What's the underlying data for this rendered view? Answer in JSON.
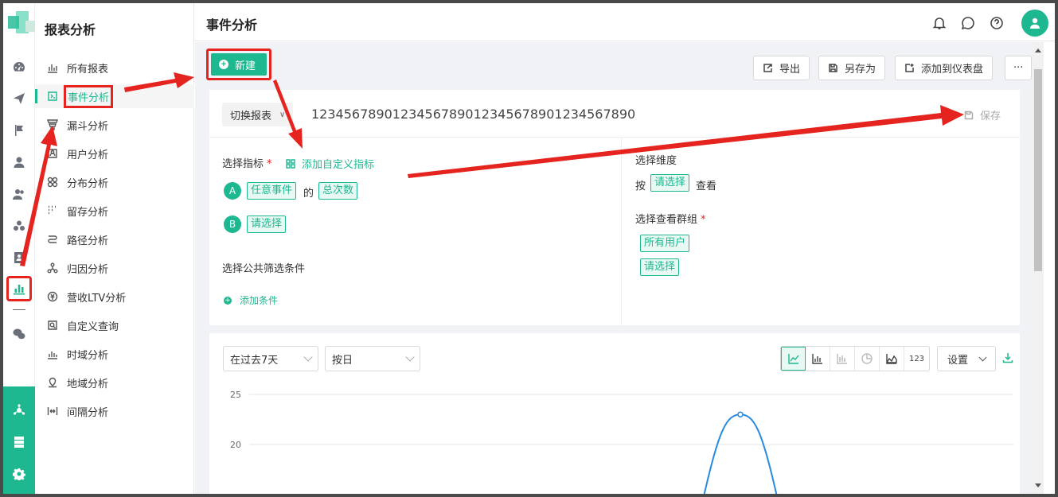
{
  "colors": {
    "accent": "#1db890",
    "annotation": "#e5231f"
  },
  "sidebar": {
    "title": "报表分析",
    "items": [
      {
        "label": "所有报表",
        "icon": "bar-chart-icon"
      },
      {
        "label": "事件分析",
        "icon": "event-icon",
        "active": true
      },
      {
        "label": "漏斗分析",
        "icon": "funnel-icon"
      },
      {
        "label": "用户分析",
        "icon": "user-icon"
      },
      {
        "label": "分布分析",
        "icon": "distribution-icon"
      },
      {
        "label": "留存分析",
        "icon": "retention-icon"
      },
      {
        "label": "路径分析",
        "icon": "path-icon"
      },
      {
        "label": "归因分析",
        "icon": "attribution-icon"
      },
      {
        "label": "营收LTV分析",
        "icon": "revenue-icon"
      },
      {
        "label": "自定义查询",
        "icon": "query-icon"
      },
      {
        "label": "时域分析",
        "icon": "time-icon"
      },
      {
        "label": "地域分析",
        "icon": "region-icon"
      },
      {
        "label": "间隔分析",
        "icon": "interval-icon"
      }
    ]
  },
  "header": {
    "title": "事件分析"
  },
  "toolbar": {
    "new_label": "新建",
    "export_label": "导出",
    "save_as_label": "另存为",
    "add_dashboard_label": "添加到仪表盘",
    "more_label": "···"
  },
  "report": {
    "switch_label": "切换报表",
    "name": "1234567890123456789012345678901234567890",
    "save_label": "保存"
  },
  "metrics": {
    "label": "选择指标",
    "required_mark": "*",
    "add_custom_label": "添加自定义指标",
    "rows": [
      {
        "badge": "A",
        "event": "任意事件",
        "of": "的",
        "measure": "总次数"
      },
      {
        "badge": "B",
        "event": "请选择"
      }
    ]
  },
  "filters": {
    "label": "选择公共筛选条件",
    "add_label": "添加条件"
  },
  "dimension": {
    "label": "选择维度",
    "by": "按",
    "value": "请选择",
    "view": "查看"
  },
  "groups": {
    "label": "选择查看群组",
    "required_mark": "*",
    "tags": [
      "所有用户",
      "请选择"
    ]
  },
  "chart_controls": {
    "range": "在过去7天",
    "granularity": "按日",
    "types": [
      "line-chart-icon",
      "bar-chart-icon",
      "stacked-bar-icon",
      "pie-chart-icon",
      "area-chart-icon",
      "number-icon"
    ],
    "number_label": "123",
    "settings_label": "设置"
  },
  "chart_data": {
    "type": "line",
    "y_ticks": [
      25,
      20
    ],
    "ylim": [
      18,
      25
    ],
    "series": [
      {
        "values": [
          23
        ]
      }
    ]
  }
}
